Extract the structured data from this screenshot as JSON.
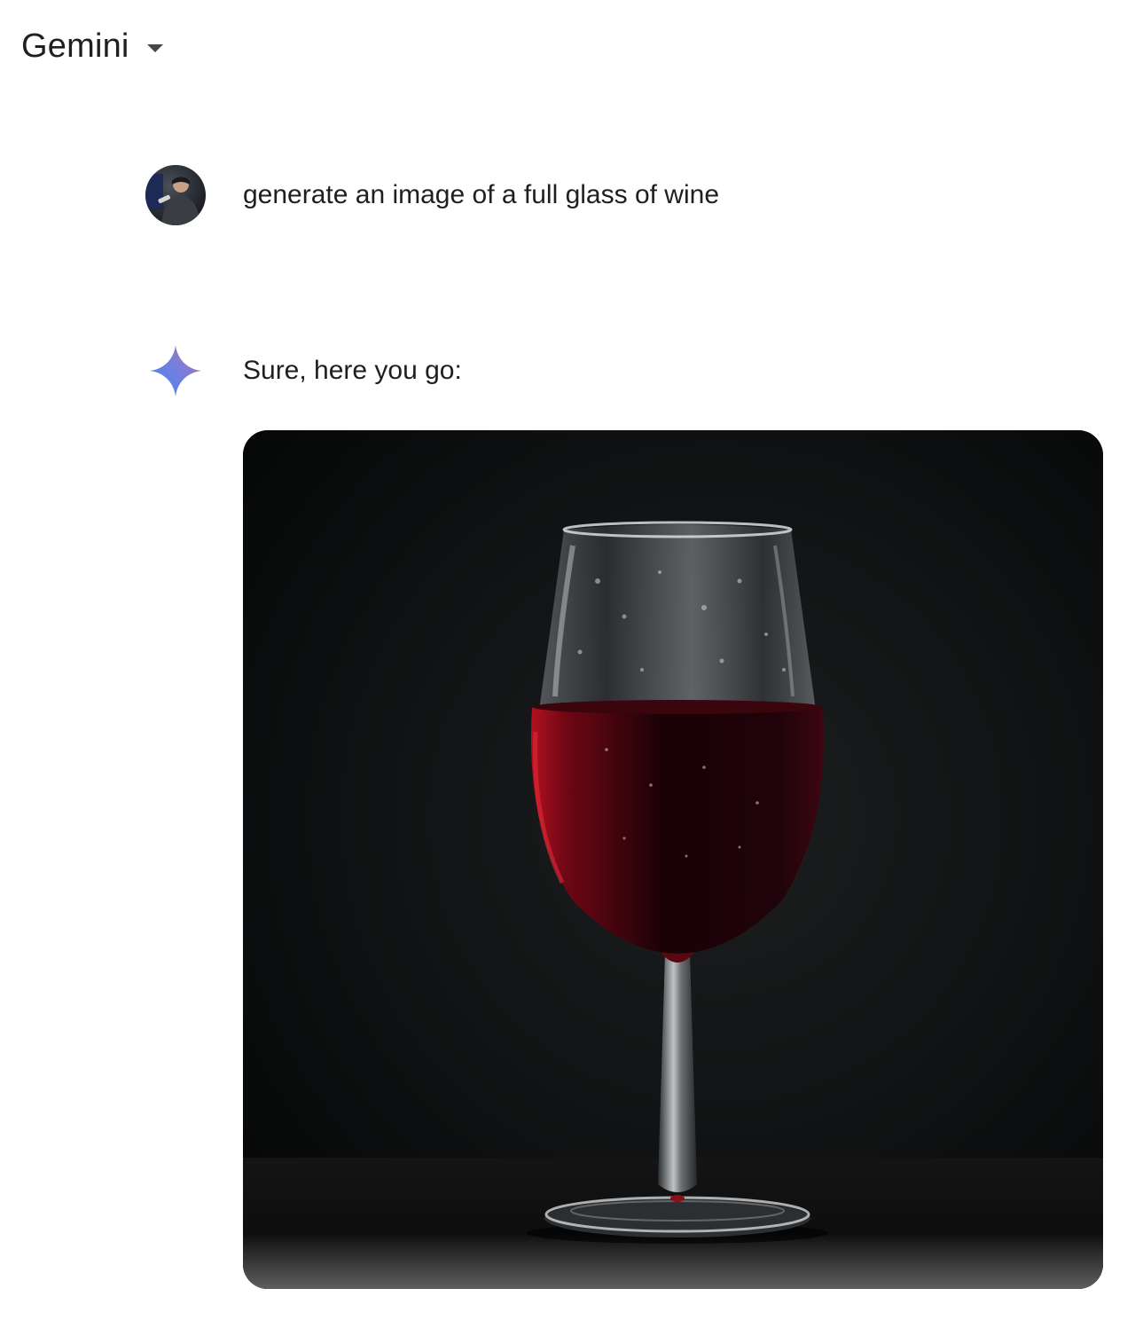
{
  "header": {
    "title": "Gemini",
    "dropdown_icon": "caret-down-icon"
  },
  "conversation": {
    "user_message": {
      "avatar": "user-avatar",
      "text": "generate an image of a full glass of wine"
    },
    "model_response": {
      "icon": "gemini-sparkle-icon",
      "text": "Sure, here you go:",
      "image": {
        "subject": "wine glass"
      }
    }
  },
  "colors": {
    "text": "#1f1f1f",
    "background": "#ffffff",
    "sparkle_blue": "#4285f4",
    "sparkle_purple": "#9b72cb",
    "wine": "#5a0612"
  }
}
